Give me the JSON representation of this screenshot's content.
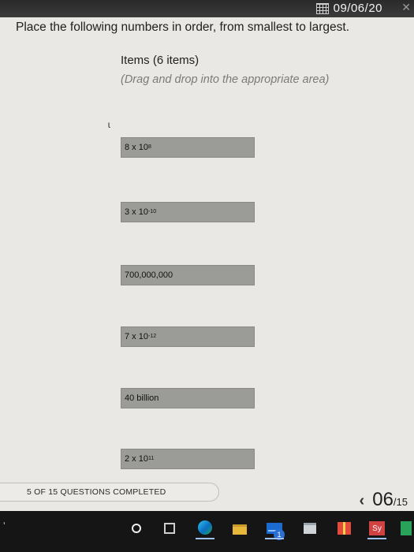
{
  "header": {
    "date": "09/06/20"
  },
  "question": {
    "instruction": "Place the following numbers in order, from smallest to largest.",
    "items_title": "Items (6 items)",
    "items_subtitle": "(Drag and drop into the appropriate area)",
    "items": [
      {
        "base": "8 x 10",
        "exp": "8"
      },
      {
        "base": "3 x 10",
        "exp": "-10"
      },
      {
        "base": "700,000,000",
        "exp": ""
      },
      {
        "base": "7 x 10",
        "exp": "-12"
      },
      {
        "base": "40 billion",
        "exp": ""
      },
      {
        "base": "2 x 10",
        "exp": "11"
      }
    ]
  },
  "footer": {
    "progress_label": "5 OF 15 QUESTIONS COMPLETED",
    "page_current": "06",
    "page_total": "/15"
  },
  "taskbar": {
    "icons": [
      "cortana-icon",
      "task-view-icon",
      "edge-icon",
      "file-explorer-icon",
      "mail-icon",
      "store-icon",
      "gift-app-icon",
      "sy-app-icon",
      "green-app-icon"
    ],
    "mail_badge": "1",
    "sy_label": "Sy"
  }
}
